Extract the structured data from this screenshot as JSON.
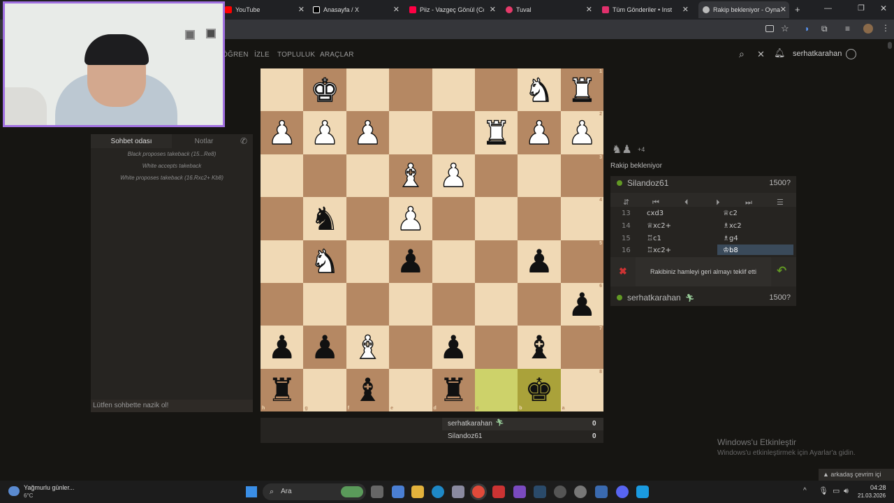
{
  "browser": {
    "tabs": [
      {
        "label": "YouTube",
        "color": "#ff0000"
      },
      {
        "label": "Anasayfa / X",
        "color": "#ffffff"
      },
      {
        "label": "Piiz - Vazgeç Gönül (Cove",
        "color": "#ff0044"
      },
      {
        "label": "Tuval",
        "color": "#e63a6a"
      },
      {
        "label": "Tüm Gönderiler • Inst",
        "color": "#e1306c"
      },
      {
        "label": "Rakip bekleniyor - Oyna",
        "color": "#bbbbbb"
      }
    ]
  },
  "nav": {
    "links": [
      "ÖĞREN",
      "İZLE",
      "TOPLULUK",
      "ARAÇLAR"
    ],
    "username": "serhatkarahan"
  },
  "board": {
    "rank_labels": [
      "1",
      "2",
      "3",
      "4",
      "5",
      "6",
      "7",
      "8"
    ],
    "file_labels": [
      "h",
      "g",
      "f",
      "e",
      "d",
      "c",
      "b",
      "a"
    ],
    "rows": [
      [
        "",
        "K",
        "",
        "",
        "",
        "",
        "N",
        "R"
      ],
      [
        "P",
        "P",
        "P",
        "",
        "",
        "R",
        "P",
        "P"
      ],
      [
        "",
        "",
        "",
        "B",
        "P",
        "",
        "",
        ""
      ],
      [
        "",
        "n",
        "",
        "P",
        "",
        "",
        "",
        ""
      ],
      [
        "",
        "N",
        "",
        "p",
        "",
        "",
        "p",
        ""
      ],
      [
        "",
        "",
        "",
        "",
        "",
        "",
        "",
        "p"
      ],
      [
        "p",
        "p",
        "B",
        "",
        "p",
        "",
        "b",
        ""
      ],
      [
        "r",
        "",
        "b",
        "",
        "r",
        "",
        "k",
        ""
      ]
    ],
    "highlight_squares": [
      "c8",
      "b8"
    ],
    "colors": {
      "light": "#f0d9b5",
      "dark": "#b58863",
      "highlight": "#cdd26a"
    }
  },
  "chat": {
    "tabs": [
      "Sohbet odası",
      "Notlar"
    ],
    "messages": [
      "Black proposes takeback (15...Re8)",
      "White accepts takeback",
      "White proposes takeback (16.Rxc2+ Kb8)"
    ],
    "input_placeholder": "Lütfen sohbette nazik ol!"
  },
  "game": {
    "captured": "+4",
    "status": "Rakip bekleniyor",
    "opponent": {
      "name": "Silandoz61",
      "rating": "1500?"
    },
    "player": {
      "name": "serhatkarahan",
      "rating": "1500?"
    },
    "moves": [
      {
        "num": "13",
        "white": "cxd3",
        "black": "♕c2"
      },
      {
        "num": "14",
        "white": "♕xc2+",
        "black": "♗xc2"
      },
      {
        "num": "15",
        "white": "♖c1",
        "black": "♗g4"
      },
      {
        "num": "16",
        "white": "♖xc2+",
        "black": "♔b8"
      }
    ],
    "takeback_text": "Rakibiniz hamleyi geri almayı teklif etti"
  },
  "score": {
    "rows": [
      {
        "name": "serhatkarahan",
        "score": "0"
      },
      {
        "name": "Silandoz61",
        "score": "0"
      }
    ]
  },
  "watermark": {
    "title": "Windows'u Etkinleştir",
    "sub": "Windows'u etkinleştirmek için Ayarlar'a gidin."
  },
  "friends": "arkadaş çevrim içi",
  "taskbar": {
    "weather_title": "Yağmurlu günler...",
    "weather_temp": "6°C",
    "search": "Ara",
    "time": "04:28",
    "date": "21.03.2026"
  }
}
